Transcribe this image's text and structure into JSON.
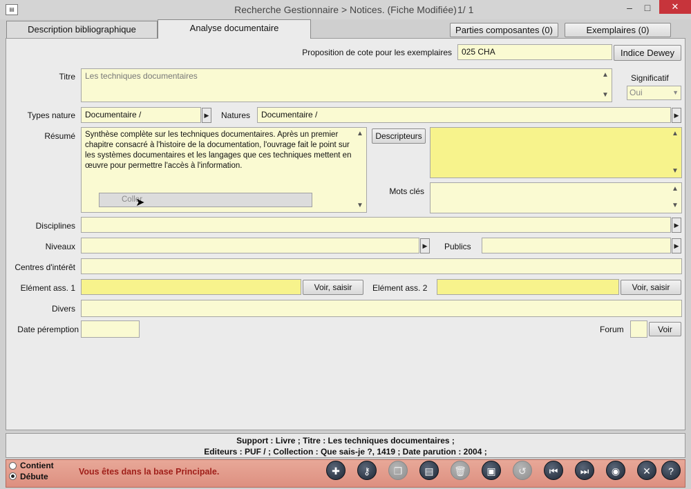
{
  "window": {
    "title": "Recherche Gestionnaire > Notices.  (Fiche Modifiée)",
    "counter": "1/    1",
    "app_icon": "app-icon",
    "minimize": "–",
    "maximize": "□",
    "close": "✕"
  },
  "tabs": [
    {
      "label": "Description bibliographique"
    },
    {
      "label": "Analyse documentaire"
    }
  ],
  "header_buttons": {
    "parties": "Parties composantes (0)",
    "exemplaires": "Exemplaires (0)"
  },
  "cote": {
    "label": "Proposition de cote pour les exemplaires",
    "value": "025 CHA",
    "button": "Indice Dewey"
  },
  "titre": {
    "label": "Titre",
    "value": "Les techniques documentaires"
  },
  "significatif": {
    "label": "Significatif",
    "value": "Oui"
  },
  "types_nature": {
    "label": "Types nature",
    "value": "Documentaire /"
  },
  "natures": {
    "label": "Natures",
    "value": "Documentaire /"
  },
  "resume": {
    "label": "Résumé",
    "value": "Synthèse complète sur les techniques documentaires. Après un premier chapitre consacré à l'histoire de la documentation, l'ouvrage fait le point sur les systèmes documentaires et les langages que ces techniques mettent en œuvre pour permettre l'accès à l'information.",
    "context_item": "Coller"
  },
  "descripteurs": {
    "button": "Descripteurs",
    "value": ""
  },
  "mots_cles": {
    "label": "Mots clés",
    "value": ""
  },
  "disciplines": {
    "label": "Disciplines",
    "value": ""
  },
  "niveaux": {
    "label": "Niveaux",
    "value": ""
  },
  "publics": {
    "label": "Publics",
    "value": ""
  },
  "centres": {
    "label": "Centres d'intérêt",
    "value": ""
  },
  "element1": {
    "label": "Elément ass. 1",
    "value": "",
    "button": "Voir, saisir"
  },
  "element2": {
    "label": "Elément ass. 2",
    "value": "",
    "button": "Voir, saisir"
  },
  "divers": {
    "label": "Divers",
    "value": ""
  },
  "date_peremption": {
    "label": "Date péremption",
    "value": ""
  },
  "forum": {
    "label": "Forum",
    "value": "",
    "button": "Voir"
  },
  "summary": {
    "line1": "Support  : Livre ;  Titre  : Les techniques documentaires ;",
    "line2": "Editeurs  : PUF / ;  Collection  : Que sais-je ?, 1419 ;  Date parution  : 2004 ;"
  },
  "status": {
    "radio1": "Contient",
    "radio2": "Débute",
    "message": "Vous êtes dans la base Principale.",
    "colors": {
      "status_bg": "#dd8f80",
      "message": "#a0201a",
      "field": "#fafad2"
    }
  },
  "toolbar": [
    {
      "name": "new-record-icon",
      "glyph": "✚"
    },
    {
      "name": "key-icon",
      "glyph": "⚷"
    },
    {
      "name": "copy-icon",
      "glyph": "❐"
    },
    {
      "name": "document-icon",
      "glyph": "▤"
    },
    {
      "name": "trash-icon",
      "glyph": "🗑"
    },
    {
      "name": "save-icon",
      "glyph": "▣"
    },
    {
      "name": "undo-icon",
      "glyph": "↺"
    },
    {
      "name": "first-record-icon",
      "glyph": "⏮"
    },
    {
      "name": "last-record-icon",
      "glyph": "⏭"
    },
    {
      "name": "eye-icon",
      "glyph": "◉"
    },
    {
      "name": "close-icon",
      "glyph": "✕"
    },
    {
      "name": "help-icon",
      "glyph": "?"
    }
  ]
}
